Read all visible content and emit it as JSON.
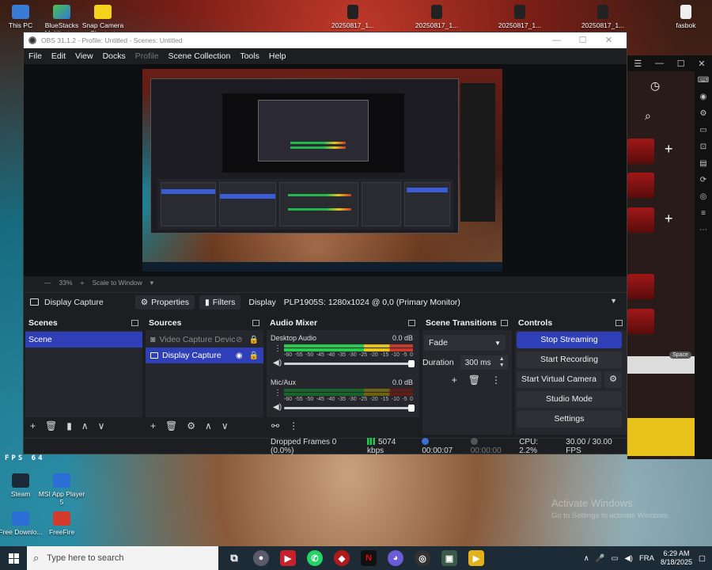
{
  "desktop": {
    "icons_top": [
      {
        "label": "This PC"
      },
      {
        "label": "BlueStacks Multiinsta..."
      },
      {
        "label": "Snap Camera Shortcut"
      },
      {
        "label": "20250817_1..."
      },
      {
        "label": "20250817_1..."
      },
      {
        "label": "20250817_1..."
      },
      {
        "label": "20250817_1..."
      },
      {
        "label": "20250817_1..."
      },
      {
        "label": "fasbok"
      }
    ],
    "icons_bottom": [
      {
        "label": "Steam"
      },
      {
        "label": "MSI App Player 5"
      },
      {
        "label": "Free Downlo..."
      },
      {
        "label": "FreeFire"
      }
    ],
    "fps_overlay": "FPS 64",
    "watermark": {
      "line1": "Activate Windows",
      "line2": "Go to Settings to activate Windows."
    },
    "emulator": {
      "space_label": "Space"
    }
  },
  "obs": {
    "title": "OBS 31.1.2 - Profile: Untitled - Scenes: Untitled",
    "menu": [
      "File",
      "Edit",
      "View",
      "Docks",
      "Profile",
      "Scene Collection",
      "Tools",
      "Help"
    ],
    "zoom": "33%",
    "scale_mode": "Scale to Window",
    "source_toolbar": {
      "source_name": "Display Capture",
      "properties_label": "Properties",
      "filters_label": "Filters",
      "display_label": "Display",
      "display_value": "PLP1905S: 1280x1024 @ 0,0 (Primary Monitor)"
    },
    "scenes": {
      "title": "Scenes",
      "items": [
        "Scene"
      ]
    },
    "sources": {
      "title": "Sources",
      "items": [
        {
          "label": "Video Capture Devic",
          "disabled": true
        },
        {
          "label": "Display Capture",
          "disabled": false
        }
      ]
    },
    "audio_mixer": {
      "title": "Audio Mixer",
      "channels": [
        {
          "name": "Desktop Audio",
          "db": "0.0 dB",
          "level": 1.0
        },
        {
          "name": "Mic/Aux",
          "db": "0.0 dB",
          "level": 1.0
        }
      ],
      "ticks": [
        "-60",
        "-55",
        "-50",
        "-45",
        "-40",
        "-35",
        "-30",
        "-25",
        "-20",
        "-15",
        "-10",
        "-5",
        "0"
      ]
    },
    "transitions": {
      "title": "Scene Transitions",
      "selected": "Fade",
      "duration_label": "Duration",
      "duration_value": "300 ms"
    },
    "controls": {
      "title": "Controls",
      "stop_streaming": "Stop Streaming",
      "start_recording": "Start Recording",
      "start_virtual_camera": "Start Virtual Camera",
      "studio_mode": "Studio Mode",
      "settings": "Settings"
    },
    "status": {
      "dropped_frames": "Dropped Frames 0 (0.0%)",
      "bitrate": "5074 kbps",
      "stream_time": "00:00:07",
      "record_time": "00:00:00",
      "cpu": "CPU: 2.2%",
      "fps": "30.00 / 30.00 FPS"
    }
  },
  "taskbar": {
    "search_placeholder": "Type here to search",
    "language": "FRA",
    "time": "6:29 AM",
    "date": "8/18/2025"
  },
  "colors": {
    "accent": "#2e3fb8",
    "meter_green": "#28c94f",
    "meter_yellow": "#e8c41a",
    "meter_red": "#c83a2c"
  }
}
